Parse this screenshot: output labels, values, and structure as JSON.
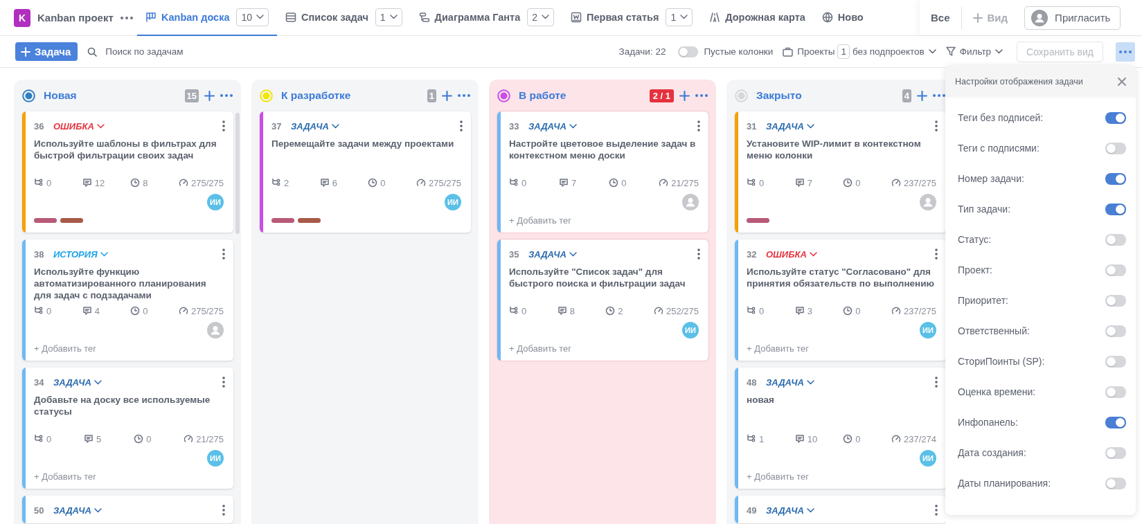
{
  "header": {
    "project_initial": "K",
    "project_name": "Kanban проект"
  },
  "tabs": [
    {
      "label": "Kanban доска",
      "count": "10",
      "selected": true
    },
    {
      "label": "Список задач",
      "count": "1",
      "selected": false
    },
    {
      "label": "Диаграмма Ганта",
      "count": "2",
      "selected": false
    },
    {
      "label": "Первая статья",
      "count": "1",
      "selected": false
    },
    {
      "label": "Дорожная карта",
      "selected": false
    },
    {
      "label": "Ново",
      "selected": false
    }
  ],
  "view_actions": {
    "all": "Все",
    "add_view": "Вид",
    "invite": "Пригласить"
  },
  "toolbar": {
    "add_task": "Задача",
    "search_placeholder": "Поиск по задачам",
    "task_count": "Задачи: 22",
    "empty_columns": {
      "label": "Пустые колонки",
      "on": false
    },
    "projects": {
      "label": "Проекты",
      "count": "1",
      "mode": "без подпроектов"
    },
    "filter": "Фильтр",
    "save_view": {
      "label": "Сохранить вид",
      "disabled": true
    }
  },
  "columns": [
    {
      "title": "Новая",
      "color": "#2f7fc1",
      "count": "15",
      "over_limit": false,
      "cards": [
        {
          "number": "36",
          "type": {
            "label": "ОШИБКА",
            "kind": "bug"
          },
          "color": "#f5a100",
          "title": "Используйте шаблоны в фильтрах для быстрой фильтрации своих задач",
          "subtasks": "0",
          "comments": "12",
          "time": "8",
          "progress": "275/275",
          "assignee": {
            "kind": "initials",
            "text": "ИИ"
          },
          "tags": [
            {
              "color": "#b85a78"
            },
            {
              "color": "#a85a48"
            }
          ]
        },
        {
          "number": "38",
          "type": {
            "label": "ИСТОРИЯ",
            "kind": "story"
          },
          "color": "#6db9f2",
          "title": "Используйте функцию автоматизированного планирования для задач с подзадачами",
          "subtasks": "0",
          "comments": "4",
          "time": "0",
          "progress": "275/275",
          "assignee": {
            "kind": "placeholder"
          },
          "add_tag": "+ Добавить тег"
        },
        {
          "number": "34",
          "type": {
            "label": "ЗАДАЧА",
            "kind": "task"
          },
          "color": "#6db9f2",
          "title": "Добавьте на доску все используемые статусы",
          "subtasks": "0",
          "comments": "5",
          "time": "0",
          "progress": "21/275",
          "assignee": {
            "kind": "initials",
            "text": "ИИ"
          },
          "add_tag": "+ Добавить тег"
        },
        {
          "number": "50",
          "type": {
            "label": "ЗАДАЧА",
            "kind": "task"
          },
          "color": "#6db9f2"
        }
      ]
    },
    {
      "title": "К разработке",
      "color": "#f3e600",
      "count": "1",
      "over_limit": false,
      "cards": [
        {
          "number": "37",
          "type": {
            "label": "ЗАДАЧА",
            "kind": "task"
          },
          "color": "#c94ee6",
          "title": "Перемещайте задачи между проектами",
          "subtasks": "2",
          "comments": "6",
          "time": "0",
          "progress": "275/275",
          "assignee": {
            "kind": "initials",
            "text": "ИИ"
          },
          "tags": [
            {
              "color": "#b85a78"
            },
            {
              "color": "#a85a48"
            }
          ]
        }
      ]
    },
    {
      "title": "В работе",
      "color": "#c94ee6",
      "count": "2 / 1",
      "over_limit": true,
      "cards": [
        {
          "number": "33",
          "type": {
            "label": "ЗАДАЧА",
            "kind": "task"
          },
          "color": "#6db9f2",
          "title": "Настройте цветовое выделение задач в контекстном меню доски",
          "subtasks": "0",
          "comments": "7",
          "time": "0",
          "progress": "21/275",
          "assignee": {
            "kind": "placeholder"
          },
          "add_tag": "+ Добавить тег"
        },
        {
          "number": "35",
          "type": {
            "label": "ЗАДАЧА",
            "kind": "task"
          },
          "color": "#6db9f2",
          "title": "Используйте \"Список задач\" для быстрого поиска и фильтрации задач",
          "subtasks": "0",
          "comments": "8",
          "time": "2",
          "progress": "252/275",
          "assignee": {
            "kind": "initials",
            "text": "ИИ"
          },
          "add_tag": "+ Добавить тег"
        }
      ]
    },
    {
      "title": "Закрыто",
      "color": "#d6d7da",
      "count": "4",
      "over_limit": false,
      "cards": [
        {
          "number": "31",
          "type": {
            "label": "ЗАДАЧА",
            "kind": "task"
          },
          "color": "#f5a100",
          "title": "Установите WIP-лимит в контекстном меню колонки",
          "subtasks": "0",
          "comments": "7",
          "time": "0",
          "progress": "237/275",
          "assignee": {
            "kind": "placeholder"
          },
          "tags": [
            {
              "color": "#b85a78"
            }
          ]
        },
        {
          "number": "32",
          "type": {
            "label": "ОШИБКА",
            "kind": "bug"
          },
          "color": "#6db9f2",
          "title": "Используйте статус \"Согласовано\" для принятия обязательств по выполнению",
          "subtasks": "0",
          "comments": "3",
          "time": "0",
          "progress": "237/275",
          "assignee": {
            "kind": "initials",
            "text": "ИИ"
          },
          "add_tag": "+ Добавить тег"
        },
        {
          "number": "48",
          "type": {
            "label": "ЗАДАЧА",
            "kind": "task"
          },
          "color": "#6db9f2",
          "title": "новая",
          "subtasks": "1",
          "comments": "10",
          "time": "0",
          "progress": "237/274",
          "assignee": {
            "kind": "initials",
            "text": "ИИ"
          },
          "add_tag": "+ Добавить тег"
        },
        {
          "number": "49",
          "type": {
            "label": "ЗАДАЧА",
            "kind": "task"
          },
          "color": "#6db9f2"
        }
      ]
    }
  ],
  "panel": {
    "title": "Настройки отображения задачи",
    "options": [
      {
        "label": "Теги без подписей:",
        "on": true
      },
      {
        "label": "Теги с подписями:",
        "on": false
      },
      {
        "label": "Номер задачи:",
        "on": true
      },
      {
        "label": "Тип задачи:",
        "on": true
      },
      {
        "label": "Статус:",
        "on": false
      },
      {
        "label": "Проект:",
        "on": false
      },
      {
        "label": "Приоритет:",
        "on": false
      },
      {
        "label": "Ответственный:",
        "on": false
      },
      {
        "label": "СториПоинты (SP):",
        "on": false
      },
      {
        "label": "Оценка времени:",
        "on": false
      },
      {
        "label": "Инфопанель:",
        "on": true
      },
      {
        "label": "Дата создания:",
        "on": false
      },
      {
        "label": "Даты планирования:",
        "on": false
      }
    ]
  }
}
